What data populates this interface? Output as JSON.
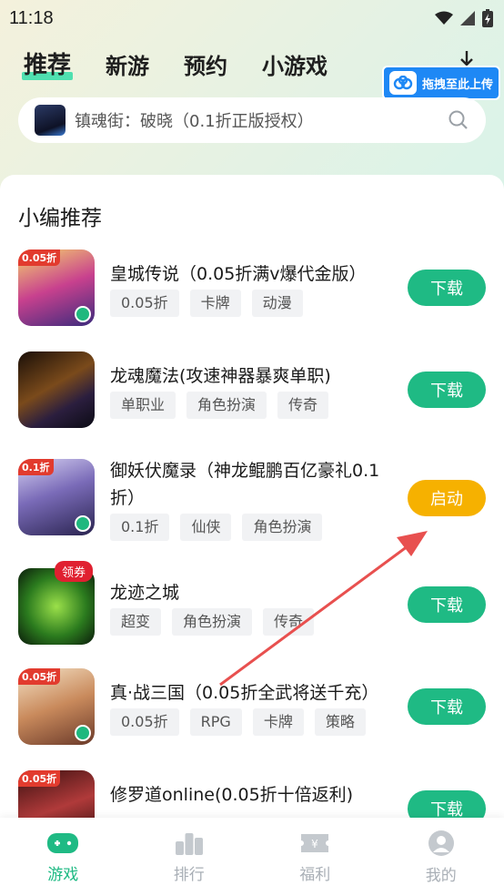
{
  "status": {
    "time": "11:18"
  },
  "tabs": [
    {
      "label": "推荐",
      "active": true
    },
    {
      "label": "新游",
      "active": false
    },
    {
      "label": "预约",
      "active": false
    },
    {
      "label": "小游戏",
      "active": false
    }
  ],
  "upload": {
    "label": "拖拽至此上传"
  },
  "search": {
    "placeholder": "镇魂街：破晓（0.1折正版授权）"
  },
  "section": {
    "title": "小编推荐"
  },
  "games": [
    {
      "name": "皇城传说（0.05折满v爆代金版）",
      "tags": [
        "0.05折",
        "卡牌",
        "动漫"
      ],
      "action": "下载",
      "corner": "0.05折"
    },
    {
      "name": "龙魂魔法(攻速神器暴爽单职)",
      "tags": [
        "单职业",
        "角色扮演",
        "传奇"
      ],
      "action": "下载",
      "corner": ""
    },
    {
      "name": "御妖伏魔录（神龙鲲鹏百亿豪礼0.1折）",
      "tags": [
        "0.1折",
        "仙侠",
        "角色扮演"
      ],
      "action": "启动",
      "corner": "0.1折"
    },
    {
      "name": "龙迹之城",
      "tags": [
        "超变",
        "角色扮演",
        "传奇"
      ],
      "action": "下载",
      "corner": "",
      "coupon": "领券"
    },
    {
      "name": "真·战三国（0.05折全武将送千充）",
      "tags": [
        "0.05折",
        "RPG",
        "卡牌",
        "策略"
      ],
      "action": "下载",
      "corner": "0.05折"
    },
    {
      "name": "修罗道online(0.05折十倍返利)",
      "tags": [],
      "action": "下载",
      "corner": "0.05折"
    }
  ],
  "nav": [
    {
      "label": "游戏",
      "icon": "gamepad-icon",
      "active": true
    },
    {
      "label": "排行",
      "icon": "ranking-icon",
      "active": false
    },
    {
      "label": "福利",
      "icon": "ticket-icon",
      "active": false
    },
    {
      "label": "我的",
      "icon": "user-icon",
      "active": false
    }
  ],
  "colors": {
    "accent": "#1fba84",
    "launch": "#f6b100",
    "upload": "#1e88f5",
    "arrow": "#e8504f"
  }
}
